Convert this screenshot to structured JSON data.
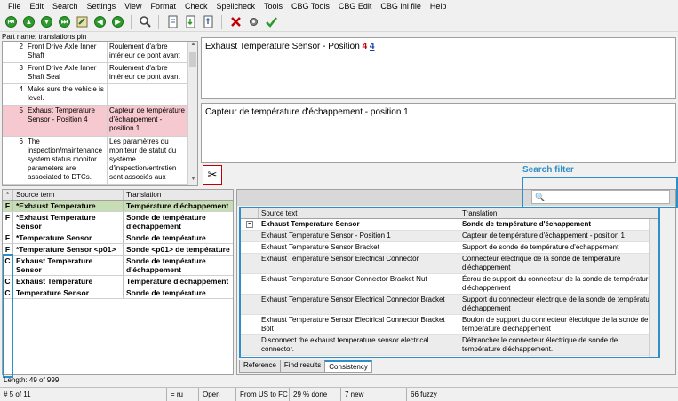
{
  "menu": [
    "File",
    "Edit",
    "Search",
    "Settings",
    "View",
    "Format",
    "Check",
    "Spellcheck",
    "Tools",
    "CBG Tools",
    "CBG Edit",
    "CBG Ini file",
    "Help"
  ],
  "part_name": "Part name: translations.pin",
  "segments": [
    {
      "num": "2",
      "source": "Front Drive Axle Inner Shaft",
      "target": "Roulement d'arbre intérieur de pont avant"
    },
    {
      "num": "3",
      "source": "Front Drive Axle Inner Shaft Seal",
      "target": "Roulement d'arbre intérieur de pont avant"
    },
    {
      "num": "4",
      "source": "Make sure the vehicle is level.",
      "target": ""
    },
    {
      "num": "5",
      "source": "Exhaust Temperature Sensor - Position 4",
      "target": "Capteur de température d'échappement - position 1"
    },
    {
      "num": "6",
      "source": "The inspection/maintenance system status monitor parameters are associated to DTCs.",
      "target": "Les paramètres du moniteur de statut du système d'inspection/entretien sont associés aux"
    }
  ],
  "source_editor": {
    "text": "Exhaust Temperature Sensor - Position",
    "tag": "4",
    "tag_number": "4"
  },
  "target_editor": {
    "text": "Capteur de température d'échappement - position 1"
  },
  "search_filter": {
    "label": "Search filter",
    "value": ""
  },
  "termbase": {
    "col0": "*",
    "col_source": "Source term",
    "col_translation": "Translation",
    "rows": [
      {
        "flag": "F",
        "source": "*Exhaust Temperature",
        "translation": "Température d'échappement"
      },
      {
        "flag": "F",
        "source": "*Exhaust Temperature Sensor",
        "translation": "Sonde de température d'échappement"
      },
      {
        "flag": "F",
        "source": "*Temperature Sensor",
        "translation": "Sonde de température"
      },
      {
        "flag": "F",
        "source": "*Temperature Sensor <p01>",
        "translation": "Sonde <p01> de température"
      },
      {
        "flag": "C",
        "source": "Exhaust Temperature Sensor",
        "translation": "Sonde de température d'échappement"
      },
      {
        "flag": "C",
        "source": "Exhaust Temperature",
        "translation": "Température d'échappement"
      },
      {
        "flag": "C",
        "source": "Temperature Sensor",
        "translation": "Sonde de température"
      }
    ]
  },
  "consistency": {
    "col_source": "Source text",
    "col_translation": "Translation",
    "group_expander": "−",
    "rows": [
      {
        "group": true,
        "source": "Exhaust Temperature Sensor",
        "translation": "Sonde de température d'échappement"
      },
      {
        "source": "Exhaust Temperature Sensor - Position 1",
        "translation": "Capteur de température d'échappement - position 1"
      },
      {
        "source": "Exhaust Temperature Sensor Bracket",
        "translation": "Support de sonde de température d'échappement"
      },
      {
        "source": "Exhaust Temperature Sensor Electrical Connector",
        "translation": "Connecteur électrique de la sonde de température d'échappement"
      },
      {
        "source": "Exhaust Temperature Sensor Connector Bracket Nut",
        "translation": "Écrou de support du connecteur de la sonde de température d'échappement"
      },
      {
        "source": "Exhaust Temperature Sensor Electrical Connector Bracket",
        "translation": "Support du connecteur électrique de la sonde de température d'échappement"
      },
      {
        "source": "Exhaust Temperature Sensor Electrical Connector Bracket Bolt",
        "translation": "Boulon de support du connecteur électrique de la sonde de température d'échappement"
      },
      {
        "source": "Disconnect the exhaust temperature sensor electrical connector.",
        "translation": "Débrancher le connecteur électrique de sonde de température d'échappement."
      }
    ]
  },
  "tabs": [
    "Reference",
    "Find results",
    "Consistency"
  ],
  "length": "Length: 49 of 999",
  "status": [
    "# 5 of 11",
    "= ru",
    "Open",
    "From US to FC",
    "29 % done",
    "7 new",
    "66 fuzzy"
  ],
  "colors": {
    "selected_segment": "#f6c8cf",
    "highlight_term": "#c7ddb3",
    "annotation_blue": "#2e8fc7",
    "tag_red": "#c00000"
  }
}
